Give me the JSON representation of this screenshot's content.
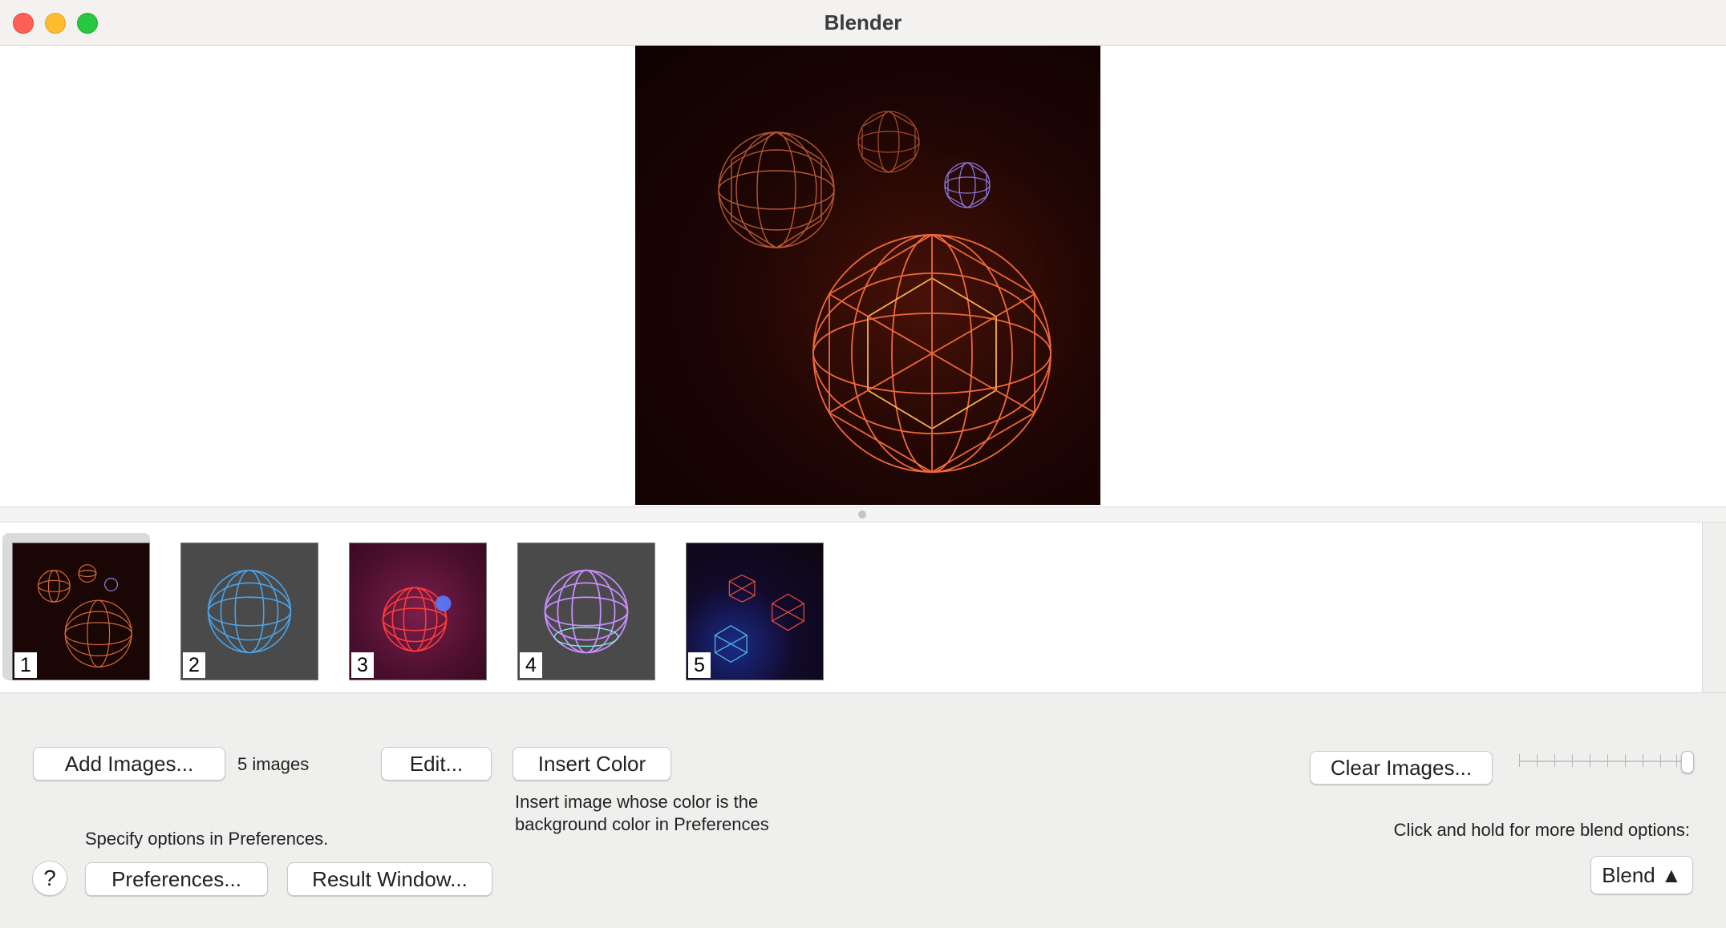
{
  "window": {
    "title": "Blender"
  },
  "thumbnails": [
    {
      "number": "1",
      "selected": true
    },
    {
      "number": "2",
      "selected": false
    },
    {
      "number": "3",
      "selected": false
    },
    {
      "number": "4",
      "selected": false
    },
    {
      "number": "5",
      "selected": false
    }
  ],
  "controls": {
    "add_images_label": "Add Images...",
    "image_count": "5 images",
    "edit_label": "Edit...",
    "insert_color_label": "Insert Color",
    "insert_color_hint_line1": "Insert image whose color is the",
    "insert_color_hint_line2": "background color in Preferences",
    "specify_options_text": "Specify options in Preferences.",
    "help_label": "?",
    "preferences_label": "Preferences...",
    "result_window_label": "Result Window...",
    "clear_images_label": "Clear Images...",
    "blend_hint": "Click and hold for more blend options:",
    "blend_label": "Blend ▲"
  },
  "colors": {
    "traffic_close": "#fe5f57",
    "traffic_minimize": "#febc2e",
    "traffic_maximize": "#28c840",
    "preview_bg": "#1e0504",
    "sphere_orange": "#f0683a"
  }
}
